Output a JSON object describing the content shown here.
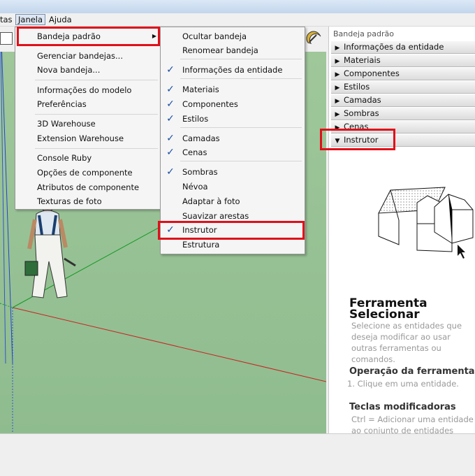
{
  "menubar": {
    "partial": "tas",
    "janela": "Janela",
    "ajuda": "Ajuda"
  },
  "janela_menu": {
    "groups": [
      {
        "items": [
          "Bandeja padrão"
        ]
      },
      {
        "items": [
          "Gerenciar bandejas...",
          "Nova bandeja..."
        ]
      },
      {
        "items": [
          "Informações do modelo",
          "Preferências"
        ]
      },
      {
        "items": [
          "3D Warehouse",
          "Extension Warehouse"
        ]
      },
      {
        "items": [
          "Console Ruby",
          "Opções de componente",
          "Atributos de componente",
          "Texturas de foto"
        ]
      }
    ],
    "submenu_arrow": "▶"
  },
  "submenu": {
    "items": [
      {
        "label": "Ocultar bandeja",
        "checked": false
      },
      {
        "label": "Renomear bandeja",
        "checked": false
      },
      {
        "label": "Informações da entidade",
        "checked": true
      },
      {
        "label": "Materiais",
        "checked": true
      },
      {
        "label": "Componentes",
        "checked": true
      },
      {
        "label": "Estilos",
        "checked": true
      },
      {
        "label": "Camadas",
        "checked": true
      },
      {
        "label": "Cenas",
        "checked": true
      },
      {
        "label": "Sombras",
        "checked": true
      },
      {
        "label": "Névoa",
        "checked": false
      },
      {
        "label": "Adaptar à foto",
        "checked": false
      },
      {
        "label": "Suavizar arestas",
        "checked": false
      },
      {
        "label": "Instrutor",
        "checked": true
      },
      {
        "label": "Estrutura",
        "checked": false
      }
    ],
    "check_glyph": "✓"
  },
  "tray": {
    "title": "Bandeja padrão",
    "panels": [
      {
        "label": "Informações da entidade",
        "arrow": "▶"
      },
      {
        "label": "Materiais",
        "arrow": "▶"
      },
      {
        "label": "Componentes",
        "arrow": "▶"
      },
      {
        "label": "Estilos",
        "arrow": "▶"
      },
      {
        "label": "Camadas",
        "arrow": "▶"
      },
      {
        "label": "Sombras",
        "arrow": "▶"
      },
      {
        "label": "Cenas",
        "arrow": "▶"
      },
      {
        "label": "Instrutor",
        "arrow": "▼"
      }
    ],
    "instructor": {
      "title_line1": "Ferramenta",
      "title_line2": "Selecionar",
      "description": "Selecione as entidades que deseja modificar ao usar outras ferramentas ou comandos.",
      "operation_heading": "Operação da ferramenta",
      "operation_step": "1.  Clique em uma entidade.",
      "modifier_heading": "Teclas modificadoras",
      "modifier_text": "Ctrl = Adicionar uma entidade ao conjunto de entidades"
    }
  },
  "colors": {
    "highlight": "#e0101a",
    "check": "#1a4fa3",
    "viewport": "#8fbc8f"
  }
}
